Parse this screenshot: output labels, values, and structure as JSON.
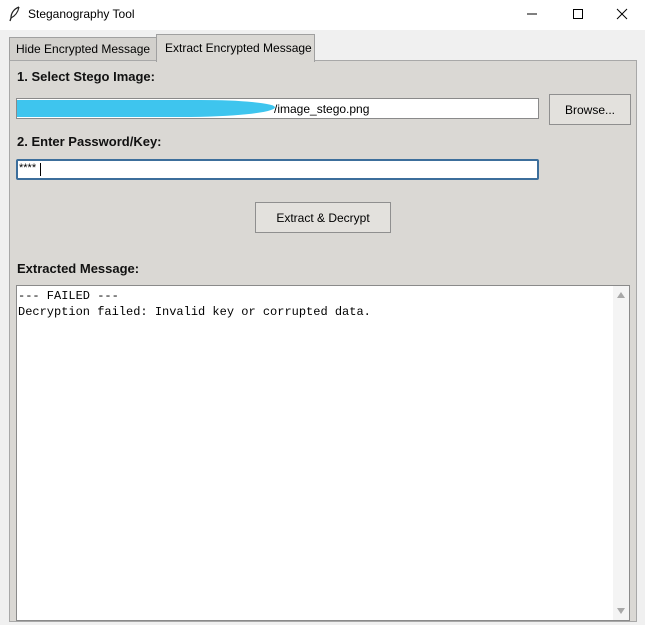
{
  "window": {
    "title": "Steganography Tool",
    "icon": "feather-icon",
    "controls": [
      "minimize-icon",
      "maximize-icon",
      "close-icon"
    ]
  },
  "tabs": [
    {
      "label": "Hide Encrypted Message",
      "selected": false
    },
    {
      "label": "Extract Encrypted Message",
      "selected": true
    }
  ],
  "extract": {
    "select_label": "1. Select Stego Image:",
    "image_path": "/image_stego.png",
    "browse_label": "Browse...",
    "password_label": "2. Enter Password/Key:",
    "password_value": "****",
    "extract_button_label": "Extract & Decrypt",
    "output_label": "Extracted Message:",
    "output_text": "--- FAILED ---\nDecryption failed: Invalid key or corrupted data."
  },
  "colors": {
    "panel_bg": "#dad8d4",
    "focus_border": "#3c6e9b",
    "redaction": "#3ec5ee"
  }
}
